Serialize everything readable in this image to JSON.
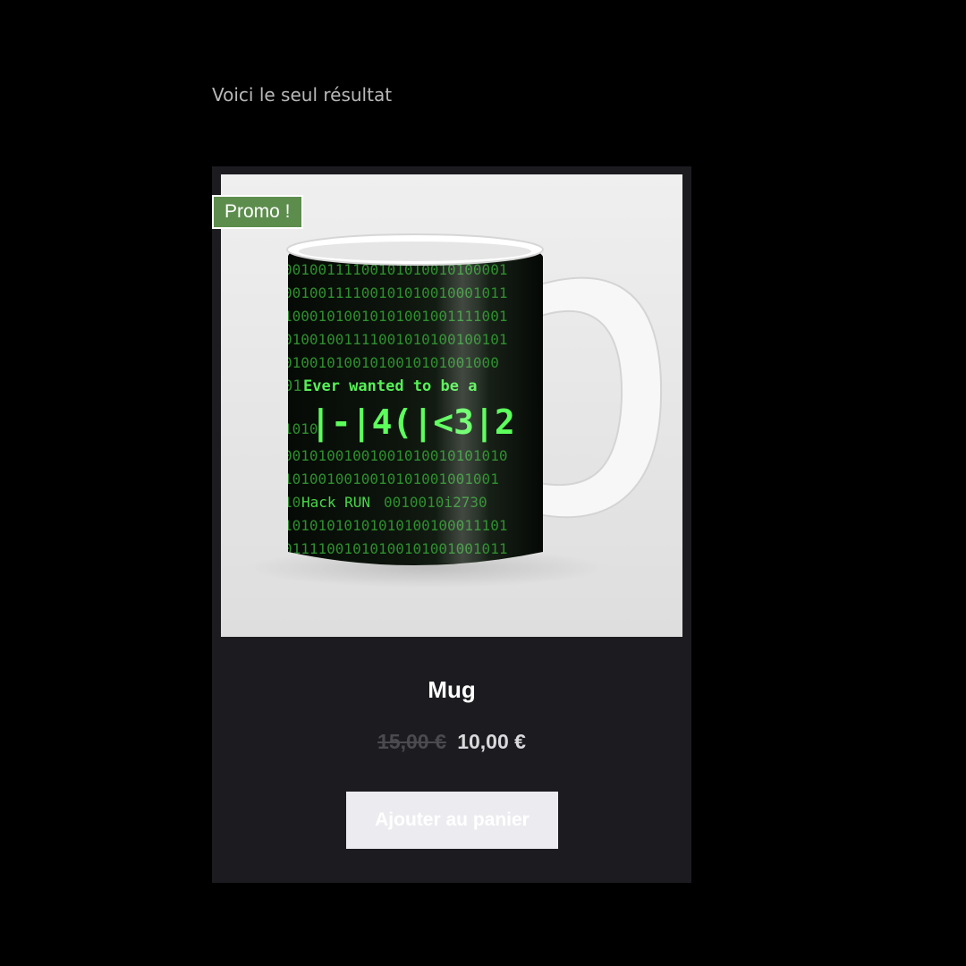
{
  "shop": {
    "result_count": "Voici le seul résultat"
  },
  "product": {
    "sale_badge": "Promo !",
    "title": "Mug",
    "price_old": "15,00 €",
    "price_new": "10,00 €",
    "add_to_cart_label": "Ajouter au panier",
    "image": {
      "subject": "white mug with green binary matrix print",
      "print_lines": {
        "line_1": "Ever wanted to be a",
        "line_2": "|-|4(|<3|2",
        "line_3": "Hack RUN"
      }
    }
  },
  "colors": {
    "background": "#000000",
    "card": "#1b1b20",
    "badge": "#5d8d4d",
    "matrix_green": "#39e639"
  }
}
